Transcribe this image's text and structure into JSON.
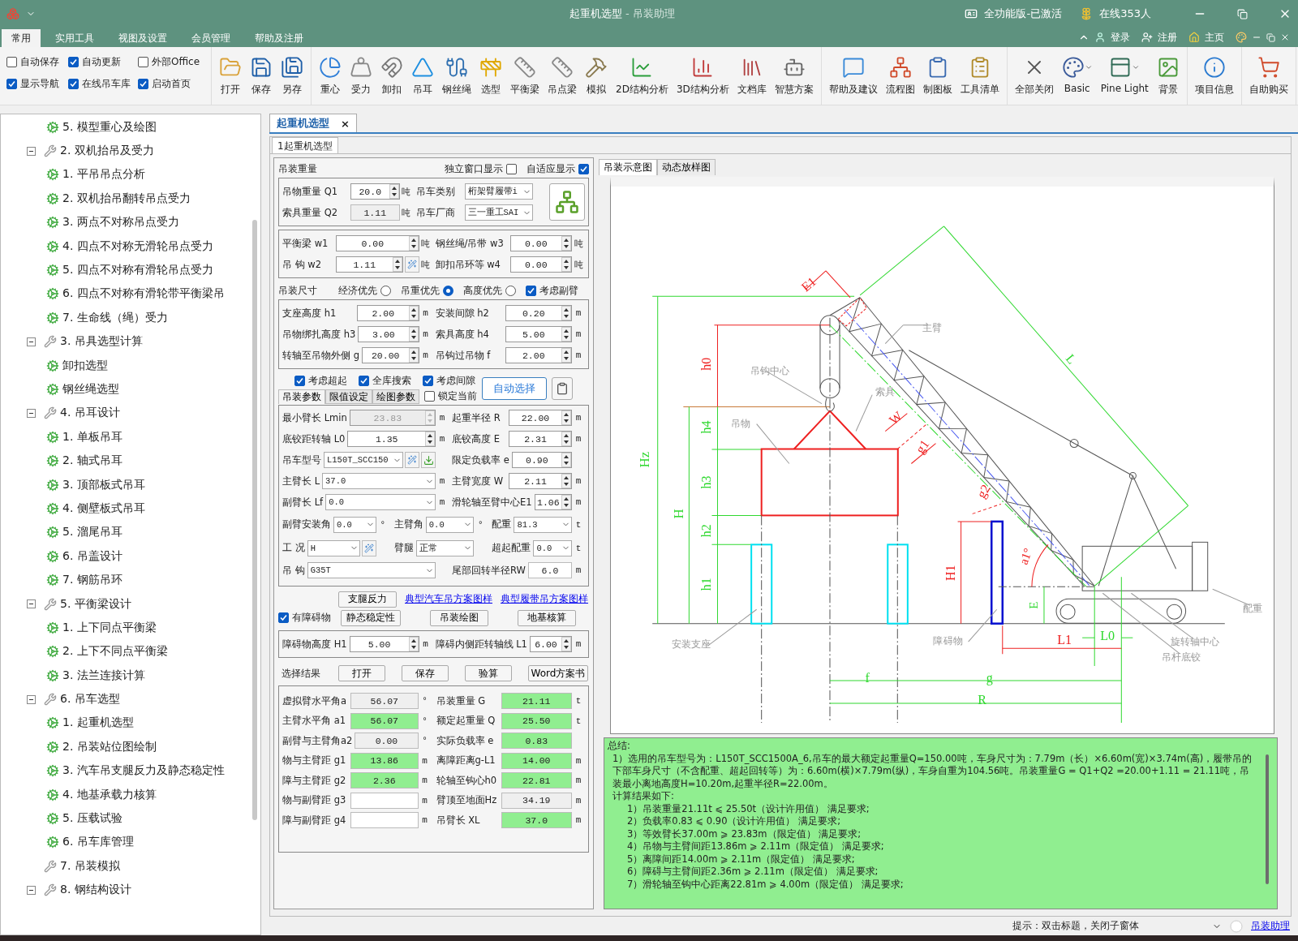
{
  "title_bar": {
    "title": "起重机选型",
    "subtitle": "- 吊装助理",
    "edition": "全功能版-已激活",
    "online": "在线353人"
  },
  "menu": {
    "tabs": [
      {
        "label": "常用",
        "selected": true
      },
      {
        "label": "实用工具",
        "selected": false
      },
      {
        "label": "视图及设置",
        "selected": false
      },
      {
        "label": "会员管理",
        "selected": false
      },
      {
        "label": "帮助及注册",
        "selected": false
      }
    ],
    "links": [
      "登录",
      "注册",
      "主页"
    ]
  },
  "ribbon": {
    "options": [
      {
        "label": "自动保存",
        "checked": false
      },
      {
        "label": "自动更新",
        "checked": true
      },
      {
        "label": "外部Office",
        "checked": false
      },
      {
        "label": "显示导航",
        "checked": true
      },
      {
        "label": "在线吊车库",
        "checked": true
      },
      {
        "label": "启动首页",
        "checked": true
      }
    ],
    "groups": [
      [
        "打开",
        "保存",
        "另存"
      ],
      [
        "重心",
        "受力",
        "卸扣",
        "吊耳",
        "钢丝绳",
        "选型",
        "平衡梁",
        "吊点梁",
        "模拟",
        "2D结构分析",
        "3D结构分析",
        "文档库",
        "智慧方案"
      ],
      [
        "帮助及建议",
        "流程图",
        "制图板",
        "工具清单"
      ],
      [
        "全部关闭",
        "Basic",
        "Pine Light",
        "背景"
      ],
      [
        "项目信息"
      ],
      [
        "自助购买"
      ]
    ]
  },
  "tree": {
    "items": [
      {
        "children": [
          {
            "label": "5. 模型重心及绘图"
          }
        ]
      },
      {
        "label": "2. 双机抬吊及受力",
        "expanded": true,
        "children": [
          {
            "label": "1. 平吊吊点分析"
          },
          {
            "label": "2. 双机抬吊翻转吊点受力"
          },
          {
            "label": "3. 两点不对称吊点受力"
          },
          {
            "label": "4. 四点不对称无滑轮吊点受力"
          },
          {
            "label": "5. 四点不对称有滑轮吊点受力"
          },
          {
            "label": "6. 四点不对称有滑轮带平衡梁吊"
          },
          {
            "label": "7. 生命线（绳）受力"
          }
        ]
      },
      {
        "label": "3. 吊具选型计算",
        "expanded": true,
        "children": [
          {
            "label": "卸扣选型"
          },
          {
            "label": "钢丝绳选型"
          }
        ]
      },
      {
        "label": "4. 吊耳设计",
        "expanded": true,
        "children": [
          {
            "label": "1. 单板吊耳"
          },
          {
            "label": "2. 轴式吊耳"
          },
          {
            "label": "3. 顶部板式吊耳"
          },
          {
            "label": "4. 侧壁板式吊耳"
          },
          {
            "label": "5. 溜尾吊耳"
          },
          {
            "label": "6. 吊盖设计"
          },
          {
            "label": "7. 钢筋吊环"
          }
        ]
      },
      {
        "label": "5. 平衡梁设计",
        "expanded": true,
        "children": [
          {
            "label": "1. 上下同点平衡梁"
          },
          {
            "label": "2. 上下不同点平衡梁"
          },
          {
            "label": "3. 法兰连接计算"
          }
        ]
      },
      {
        "label": "6. 吊车选型",
        "expanded": true,
        "children": [
          {
            "label": "1. 起重机选型"
          },
          {
            "label": "2. 吊装站位图绘制"
          },
          {
            "label": "3. 汽车吊支腿反力及静态稳定性"
          },
          {
            "label": "4. 地基承载力核算"
          },
          {
            "label": "5. 压载试验"
          },
          {
            "label": "6. 吊车库管理"
          }
        ]
      },
      {
        "label": "7. 吊装模拟"
      },
      {
        "label": "8. 钢结构设计",
        "expanded": true
      }
    ]
  },
  "document_tab": {
    "label": "起重机选型",
    "close": "×"
  },
  "inner_tab": "1起重机选型",
  "form": {
    "weight": {
      "title": "吊装重量",
      "options": [
        {
          "label": "独立窗口显示",
          "checked": false
        },
        {
          "label": "自适应显示",
          "checked": true
        }
      ],
      "rows": [
        [
          {
            "label": "吊物重量 Q1",
            "value": "20.0",
            "unit": "吨",
            "kind": "spin"
          },
          {
            "label": "吊车类别",
            "value": "桁架臂履带i",
            "kind": "select"
          }
        ],
        [
          {
            "label": "索具重量 Q2",
            "value": "1.11",
            "unit": "吨",
            "kind": "readonly"
          },
          {
            "label": "吊车厂商",
            "value": "三一重工SAI",
            "kind": "select"
          }
        ]
      ],
      "extra_rows": [
        [
          {
            "label": "平衡梁 w1",
            "value": "0.00",
            "unit": "吨",
            "kind": "spin"
          },
          {
            "label": "钢丝绳/吊带 w3",
            "value": "0.00",
            "unit": "吨",
            "kind": "spin"
          }
        ],
        [
          {
            "label": "吊 钩 w2",
            "value": "1.11",
            "unit": "吨",
            "kind": "spin",
            "tool": true
          },
          {
            "label": "卸扣吊环等 w4",
            "value": "0.00",
            "unit": "吨",
            "kind": "spin"
          }
        ]
      ]
    },
    "size": {
      "title": "吊装尺寸",
      "modes": [
        {
          "label": "经济优先",
          "selected": false
        },
        {
          "label": "吊重优先",
          "selected": true
        },
        {
          "label": "高度优先",
          "selected": false
        }
      ],
      "option": {
        "label": "考虑副臂",
        "checked": true
      },
      "rows": [
        [
          {
            "label": "支座高度 h1",
            "value": "2.00",
            "unit": "m",
            "kind": "spin"
          },
          {
            "label": "安装间隙 h2",
            "value": "0.20",
            "unit": "m",
            "kind": "spin"
          }
        ],
        [
          {
            "label": "吊物绑扎高度 h3",
            "value": "3.00",
            "unit": "m",
            "kind": "spin"
          },
          {
            "label": "索具高度 h4",
            "value": "5.00",
            "unit": "m",
            "kind": "spin"
          }
        ],
        [
          {
            "label": "转轴至吊物外侧 g",
            "value": "20.00",
            "unit": "m",
            "kind": "spin"
          },
          {
            "label": "吊钩过吊物 f",
            "value": "2.00",
            "unit": "m",
            "kind": "spin"
          }
        ]
      ]
    },
    "search": {
      "options": [
        {
          "label": "考虑超起",
          "checked": true
        },
        {
          "label": "全库搜索",
          "checked": true
        },
        {
          "label": "考虑间隙",
          "checked": true
        }
      ],
      "lock": {
        "label": "锁定当前",
        "checked": false
      },
      "button": "自动选择"
    },
    "param_tabs": [
      {
        "label": "吊装参数",
        "selected": true
      },
      {
        "label": "限值设定",
        "selected": false
      },
      {
        "label": "绘图参数",
        "selected": false
      }
    ],
    "params": [
      [
        {
          "label": "最小臂长 Lmin",
          "value": "23.83",
          "unit": "m",
          "kind": "disabled"
        },
        {
          "label": "起重半径 R",
          "value": "22.00",
          "unit": "m",
          "kind": "spin"
        }
      ],
      [
        {
          "label": "底铰距转轴 L0",
          "value": "1.35",
          "unit": "m",
          "kind": "spin"
        },
        {
          "label": "底铰高度 E",
          "value": "2.31",
          "unit": "m",
          "kind": "spin"
        }
      ],
      [
        {
          "label": "吊车型号",
          "value": "L150T_SCC150",
          "kind": "select",
          "tool": true,
          "download": true
        },
        {
          "label": "限定负载率 e",
          "value": "0.90",
          "kind": "spin"
        }
      ],
      [
        {
          "label": "主臂长  L",
          "value": "37.0",
          "unit": "m",
          "kind": "select"
        },
        {
          "label": "主臂宽度 W",
          "value": "2.11",
          "unit": "m",
          "kind": "spin"
        }
      ],
      [
        {
          "label": "副臂长 Lf",
          "value": "0.0",
          "unit": "m",
          "kind": "select"
        },
        {
          "label": "滑轮轴至臂中心E1",
          "value": "1.06",
          "unit": "m",
          "kind": "spin"
        }
      ],
      [
        {
          "label": "副臂安装角",
          "value": "0.0",
          "unit": "°",
          "kind": "select"
        },
        {
          "label": "主臂角",
          "value": "0.0",
          "unit": "°",
          "kind": "select"
        },
        {
          "label": "配重",
          "value": "81.3",
          "unit": "t",
          "kind": "select"
        }
      ],
      [
        {
          "label": "工 况",
          "value": "H",
          "kind": "select",
          "tool": true
        },
        {
          "label": "臂腿",
          "value": "正常",
          "kind": "select"
        },
        {
          "label": "超起配重",
          "value": "0.0",
          "unit": "t",
          "kind": "select"
        }
      ],
      [
        {
          "label": "吊 钩",
          "value": "G35T",
          "kind": "select"
        },
        {
          "label": "尾部回转半径RW",
          "value": "6.0",
          "unit": "m",
          "kind": "plain"
        }
      ]
    ],
    "actions": {
      "button": "支腿反力",
      "links": [
        "典型汽车吊方案图样",
        "典型履带吊方案图样"
      ]
    },
    "obstacle": {
      "option": {
        "label": "有障碍物",
        "checked": true
      },
      "buttons": [
        "静态稳定性",
        "吊装绘图",
        "地基核算"
      ],
      "fields": [
        {
          "label": "障碍物高度 H1",
          "value": "5.00",
          "unit": "m",
          "kind": "spin"
        },
        {
          "label": "障碍内侧距转轴线 L1",
          "value": "6.00",
          "unit": "m",
          "kind": "spin"
        }
      ]
    },
    "results": {
      "label": "选择结果",
      "buttons": [
        "打开",
        "保存",
        "验算",
        "Word方案书"
      ],
      "rows": [
        [
          {
            "label": "虚拟臂水平角a",
            "value": "56.07",
            "unit": "°",
            "kind": "readonly"
          },
          {
            "label": "吊装重量 G",
            "value": "21.11",
            "unit": "t",
            "kind": "ok"
          }
        ],
        [
          {
            "label": "主臂水平角 a1",
            "value": "56.07",
            "unit": "°",
            "kind": "ok"
          },
          {
            "label": "额定起重量 Q",
            "value": "25.50",
            "unit": "t",
            "kind": "ok"
          }
        ],
        [
          {
            "label": "副臂与主臂角a2",
            "value": "0.00",
            "unit": "°",
            "kind": "readonly"
          },
          {
            "label": "实际负载率 e",
            "value": "0.83",
            "kind": "ok"
          }
        ],
        [
          {
            "label": "物与主臂距 g1",
            "value": "13.86",
            "unit": "m",
            "kind": "ok"
          },
          {
            "label": "离障距离g-L1",
            "value": "14.00",
            "unit": "m",
            "kind": "ok"
          }
        ],
        [
          {
            "label": "障与主臂距 g2",
            "value": "2.36",
            "unit": "m",
            "kind": "ok"
          },
          {
            "label": "轮轴至钩心h0",
            "value": "22.81",
            "unit": "m",
            "kind": "ok"
          }
        ],
        [
          {
            "label": "物与副臂距 g3",
            "unit": "m",
            "kind": "blank"
          },
          {
            "label": "臂顶至地面Hz",
            "value": "34.19",
            "unit": "m",
            "kind": "readonly"
          }
        ],
        [
          {
            "label": "障与副臂距 g4",
            "unit": "m",
            "kind": "blank"
          },
          {
            "label": "吊臂长 XL",
            "value": "37.0",
            "unit": "m",
            "kind": "ok"
          }
        ]
      ]
    }
  },
  "diagram": {
    "tabs": [
      {
        "label": "吊装示意图",
        "selected": true
      },
      {
        "label": "动态放样图",
        "selected": false
      }
    ],
    "labels": [
      "Hz",
      "H",
      "h0",
      "h4",
      "h3",
      "h2",
      "h1",
      "E1",
      "L",
      "W",
      "g1",
      "g2",
      "H1",
      "a1°",
      "E",
      "L0",
      "L1",
      "f",
      "g",
      "R",
      "主臂",
      "吊钩中心",
      "索具",
      "吊物",
      "安装支座",
      "障碍物",
      "旋转轴中心",
      "吊杆底铰",
      "配重"
    ]
  },
  "summary": {
    "title": "总结:",
    "paragraph": "1）选用的吊车型号为：L150T_SCC1500A_6,吊车的最大额定起重量Q=150.00吨，车身尺寸为：7.79m（长）×6.60m(宽)×3.74m(高)，履带吊的下部车身尺寸（不含配重、超起回转等）为：6.60m(横)×7.79m(纵)，车身自重为104.56吨。吊装重量G = Q1+Q2 =20.00+1.11 = 21.11吨，吊装最小离地高度H=10.20m,起重半径R=22.00m。",
    "subtitle": "计算结果如下:",
    "results": [
      "1）吊装重量21.11t ⩽ 25.50t（设计许用值） 满足要求;",
      "2）负载率0.83 ⩽ 0.90（设计许用值） 满足要求;",
      "3）等效臂长37.00m ⩾ 23.83m（限定值） 满足要求;",
      "4）吊物与主臂间距13.86m ⩾ 2.11m（限定值） 满足要求;",
      "5）离障间距14.00m ⩾ 2.11m（限定值） 满足要求;",
      "6）障碍与主臂间距2.36m ⩾ 2.11m（限定值） 满足要求;",
      "7）滑轮轴至钩中心距离22.81m ⩾ 4.00m（限定值） 满足要求;"
    ]
  },
  "status_bar": {
    "hint": "提示：双击标题，关闭子窗体",
    "link": "吊装助理"
  }
}
